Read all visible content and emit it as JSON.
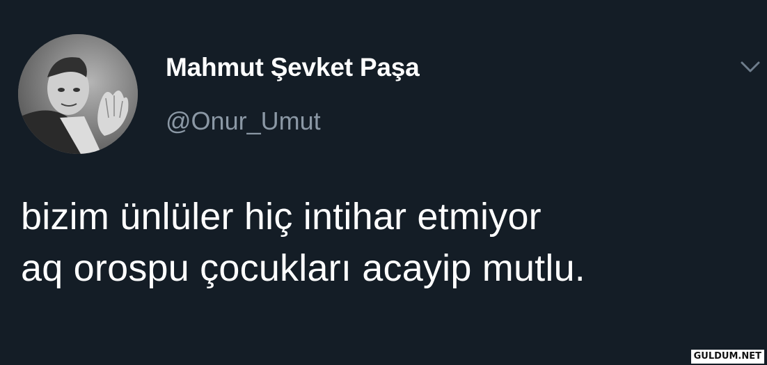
{
  "user": {
    "display_name": "Mahmut Şevket Paşa",
    "handle": "@Onur_Umut"
  },
  "tweet": {
    "lines": [
      "bizim ünlüler hiç intihar etmiyor",
      "aq orospu çocukları acayip mutlu."
    ]
  },
  "icons": {
    "menu": "chevron-down-icon",
    "avatar": "avatar"
  },
  "watermark": "GULDUM.NET",
  "colors": {
    "background": "#141d26",
    "text": "#ffffff",
    "secondary_text": "#8b98a5"
  }
}
